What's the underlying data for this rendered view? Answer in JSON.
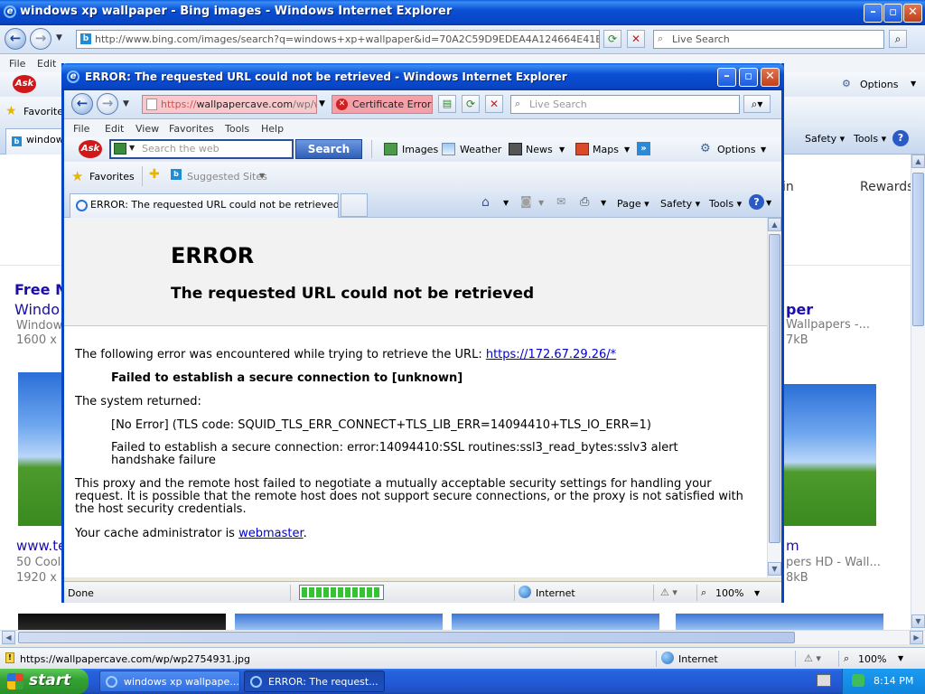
{
  "back_window": {
    "title": "windows xp wallpaper - Bing images - Windows Internet Explorer",
    "address": "http://www.bing.com/images/search?q=windows+xp+wallpaper&id=70A2C59D9EDEA4A124664E41E5BCA2859",
    "search_placeholder": "Live Search",
    "menu": [
      "File",
      "Edit"
    ],
    "options_label": "Options",
    "favorites_label": "Favorites",
    "tab_label": "windows",
    "toolbar": {
      "safety": "Safety",
      "tools": "Tools"
    },
    "page": {
      "signin_fragment": "in",
      "rewards": "Rewards",
      "left_result": {
        "title": "Free M",
        "subtitle": "Windo",
        "source": "Window",
        "dims": "1600 x"
      },
      "right_result": {
        "title": "per",
        "subtitle": "Wallpapers -...",
        "dims": "7kB"
      },
      "left_result2": {
        "title": "www.te",
        "subtitle": "50 Cool",
        "dims": "1920 x"
      },
      "right_result2": {
        "title": "m",
        "subtitle": "pers HD - Wall...",
        "dims": "8kB"
      }
    },
    "status": {
      "url": "https://wallpapercave.com/wp/wp2754931.jpg",
      "zone": "Internet",
      "zoom": "100%"
    }
  },
  "front_window": {
    "title": "ERROR: The requested URL could not be retrieved - Windows Internet Explorer",
    "address_scheme": "https://",
    "address_host": "wallpapercave.com",
    "address_rest": "/wp/we",
    "cert_error": "Certificate Error",
    "search_placeholder": "Live Search",
    "menu": [
      "File",
      "Edit",
      "View",
      "Favorites",
      "Tools",
      "Help"
    ],
    "ask": {
      "logo": "Ask",
      "search_placeholder": "Search the web",
      "search_button": "Search",
      "links": [
        "Images",
        "Weather",
        "News",
        "Maps"
      ],
      "options": "Options"
    },
    "favorites_label": "Favorites",
    "suggested_sites": "Suggested Sites",
    "tab_label": "ERROR: The requested URL could not be retrieved",
    "commands": {
      "page": "Page",
      "safety": "Safety",
      "tools": "Tools"
    },
    "status": {
      "left": "Done",
      "progress": 1.0,
      "zone": "Internet",
      "zoom": "100%"
    }
  },
  "error_page": {
    "heading": "ERROR",
    "subheading": "The requested URL could not be retrieved",
    "intro": "The following error was encountered while trying to retrieve the URL:",
    "url": "https://172.67.29.26/*",
    "failure": "Failed to establish a secure connection to [unknown]",
    "system_returned": "The system returned:",
    "no_error": "[No Error] (TLS code: SQUID_TLS_ERR_CONNECT+TLS_LIB_ERR=14094410+TLS_IO_ERR=1)",
    "ssl_error": "Failed to establish a secure connection: error:14094410:SSL routines:ssl3_read_bytes:sslv3 alert handshake failure",
    "explanation": "This proxy and the remote host failed to negotiate a mutually acceptable security settings for handling your request. It is possible that the remote host does not support secure connections, or the proxy is not satisfied with the host security credentials.",
    "admin_prefix": "Your cache administrator is",
    "admin_link": "webmaster",
    "admin_suffix": "."
  },
  "taskbar": {
    "start": "start",
    "tasks": [
      "windows xp wallpape...",
      "ERROR: The request..."
    ],
    "clock": "8:14 PM"
  },
  "colors": {
    "xp_blue": "#0845c4",
    "start_green": "#35a335",
    "cert_error_bg": "#f4a0a8",
    "progress_green": "#36c236",
    "link_blue": "#0000cc"
  }
}
